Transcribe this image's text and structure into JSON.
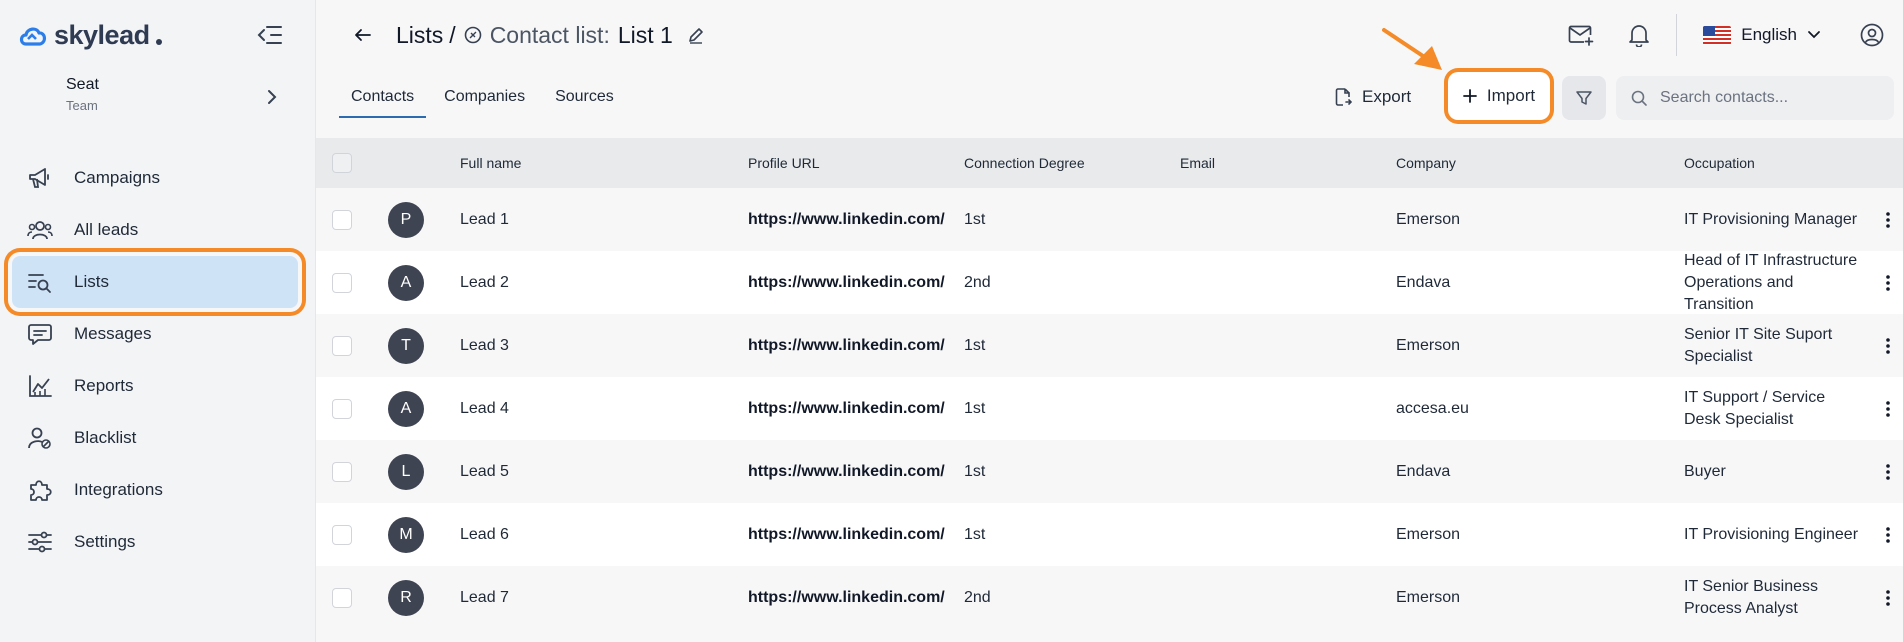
{
  "app": {
    "logo_text": "skylead"
  },
  "seat": {
    "name": "Seat",
    "team": "Team"
  },
  "nav": [
    {
      "label": "Campaigns",
      "icon": "megaphone-icon"
    },
    {
      "label": "All leads",
      "icon": "users-icon"
    },
    {
      "label": "Lists",
      "icon": "list-search-icon",
      "active": true
    },
    {
      "label": "Messages",
      "icon": "message-icon"
    },
    {
      "label": "Reports",
      "icon": "chart-icon"
    },
    {
      "label": "Blacklist",
      "icon": "user-block-icon"
    },
    {
      "label": "Integrations",
      "icon": "puzzle-icon"
    },
    {
      "label": "Settings",
      "icon": "sliders-icon"
    }
  ],
  "header": {
    "breadcrumb_lists": "Lists",
    "breadcrumb_sep": "/",
    "contact_list_label": "Contact list:",
    "list_name": "List 1",
    "language": "English"
  },
  "tabs": [
    "Contacts",
    "Companies",
    "Sources"
  ],
  "toolbar": {
    "export_label": "Export",
    "import_label": "Import",
    "search_placeholder": "Search contacts..."
  },
  "table": {
    "columns": [
      "Full name",
      "Profile URL",
      "Connection Degree",
      "Email",
      "Company",
      "Occupation"
    ],
    "rows": [
      {
        "initial": "P",
        "name": "Lead 1",
        "url": "https://www.linkedin.com/",
        "degree": "1st",
        "email": "",
        "company": "Emerson",
        "occupation": "IT Provisioning Manager"
      },
      {
        "initial": "A",
        "name": "Lead 2",
        "url": "https://www.linkedin.com/",
        "degree": "2nd",
        "email": "",
        "company": "Endava",
        "occupation": "Head of IT Infrastructure Operations and Transition"
      },
      {
        "initial": "T",
        "name": "Lead 3",
        "url": "https://www.linkedin.com/",
        "degree": "1st",
        "email": "",
        "company": "Emerson",
        "occupation": "Senior IT Site Suport Specialist"
      },
      {
        "initial": "A",
        "name": "Lead 4",
        "url": "https://www.linkedin.com/",
        "degree": "1st",
        "email": "",
        "company": "accesa.eu",
        "occupation": "IT Support / Service Desk Specialist"
      },
      {
        "initial": "L",
        "name": "Lead 5",
        "url": "https://www.linkedin.com/",
        "degree": "1st",
        "email": "",
        "company": "Endava",
        "occupation": "Buyer"
      },
      {
        "initial": "M",
        "name": "Lead 6",
        "url": "https://www.linkedin.com/",
        "degree": "1st",
        "email": "",
        "company": "Emerson",
        "occupation": "IT Provisioning Engineer"
      },
      {
        "initial": "R",
        "name": "Lead 7",
        "url": "https://www.linkedin.com/",
        "degree": "2nd",
        "email": "",
        "company": "Emerson",
        "occupation": "IT Senior Business Process Analyst"
      }
    ]
  },
  "colors": {
    "accent": "#2b6cb0",
    "highlight": "#f48b28",
    "active_nav_bg": "#cfe3f7"
  }
}
